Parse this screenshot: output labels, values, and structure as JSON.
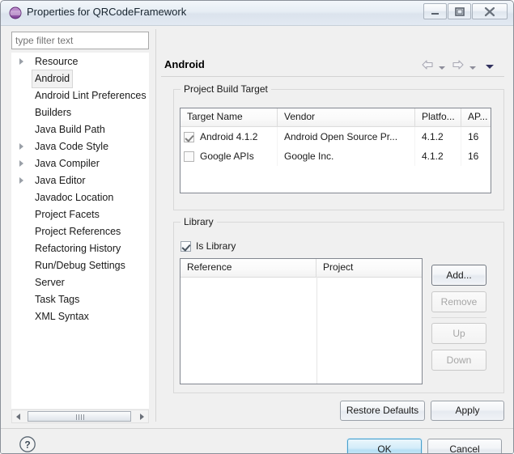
{
  "window": {
    "title": "Properties for QRCodeFramework",
    "icon": "eclipse-properties-icon",
    "controls": {
      "minimize": "Minimize",
      "maximize": "Maximize",
      "close": "Close"
    }
  },
  "sidebar": {
    "filter": {
      "placeholder": "type filter text",
      "value": ""
    },
    "items": [
      {
        "label": "Resource",
        "expandable": true,
        "selected": false
      },
      {
        "label": "Android",
        "expandable": false,
        "selected": true
      },
      {
        "label": "Android Lint Preferences",
        "expandable": false,
        "selected": false
      },
      {
        "label": "Builders",
        "expandable": false,
        "selected": false
      },
      {
        "label": "Java Build Path",
        "expandable": false,
        "selected": false
      },
      {
        "label": "Java Code Style",
        "expandable": true,
        "selected": false
      },
      {
        "label": "Java Compiler",
        "expandable": true,
        "selected": false
      },
      {
        "label": "Java Editor",
        "expandable": true,
        "selected": false
      },
      {
        "label": "Javadoc Location",
        "expandable": false,
        "selected": false
      },
      {
        "label": "Project Facets",
        "expandable": false,
        "selected": false
      },
      {
        "label": "Project References",
        "expandable": false,
        "selected": false
      },
      {
        "label": "Refactoring History",
        "expandable": false,
        "selected": false
      },
      {
        "label": "Run/Debug Settings",
        "expandable": false,
        "selected": false
      },
      {
        "label": "Server",
        "expandable": false,
        "selected": false
      },
      {
        "label": "Task Tags",
        "expandable": false,
        "selected": false
      },
      {
        "label": "XML Syntax",
        "expandable": false,
        "selected": false
      }
    ]
  },
  "page": {
    "title": "Android",
    "nav": {
      "back": "back-arrow-icon",
      "back_menu": "chevron-down-icon",
      "forward": "forward-arrow-icon",
      "forward_menu": "chevron-down-icon",
      "more": "chevron-down-filled-icon"
    }
  },
  "build_target": {
    "group_title": "Project Build Target",
    "columns": [
      "Target Name",
      "Vendor",
      "Platfo...",
      "AP..."
    ],
    "rows": [
      {
        "checked": true,
        "target_name": "Android 4.1.2",
        "vendor": "Android Open Source Pr...",
        "platform": "4.1.2",
        "api": "16"
      },
      {
        "checked": false,
        "target_name": "Google APIs",
        "vendor": "Google Inc.",
        "platform": "4.1.2",
        "api": "16"
      }
    ]
  },
  "library": {
    "group_title": "Library",
    "is_library": {
      "label": "Is Library",
      "checked": true
    },
    "columns": [
      "Reference",
      "Project"
    ],
    "rows": [],
    "buttons": [
      {
        "label": "Add...",
        "enabled": true,
        "focused": true
      },
      {
        "label": "Remove",
        "enabled": false,
        "focused": false
      },
      {
        "label": "Up",
        "enabled": false,
        "focused": false
      },
      {
        "label": "Down",
        "enabled": false,
        "focused": false
      }
    ]
  },
  "page_buttons": {
    "restore_defaults": "Restore Defaults",
    "apply": "Apply"
  },
  "dialog_buttons": {
    "help": "help-icon",
    "ok": "OK",
    "cancel": "Cancel"
  },
  "colors": {
    "dialog_background": "#f0f0f0",
    "titlebar": "#e6edf4",
    "default_button": "#b7dff4",
    "selection": "#f1f1f1",
    "icon_accent": "#9b5fb0"
  }
}
